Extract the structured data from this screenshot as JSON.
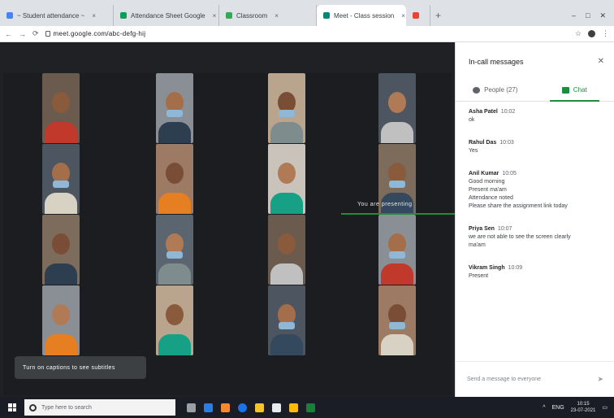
{
  "browser": {
    "tabs": [
      {
        "label": "~ Student attendance ~",
        "color": "#4285f4",
        "active": false
      },
      {
        "label": "Attendance Sheet Google",
        "color": "#0f9d58",
        "active": false
      },
      {
        "label": "Classroom",
        "color": "#34a853",
        "active": false
      },
      {
        "label": "Meet - Class session",
        "color": "#00897b",
        "active": true
      },
      {
        "label": "",
        "color": "#ea4335",
        "active": false
      }
    ],
    "new_tab": "+",
    "window_controls": [
      "–",
      "□",
      "✕"
    ],
    "url": "meet.google.com/abc-defg-hij",
    "nav": [
      "←",
      "→",
      "⟳"
    ],
    "omni_right": [
      "☆",
      "⋮"
    ]
  },
  "meet": {
    "presenter_label": "You are presenting",
    "caption_text": "Turn on captions to see subtitles"
  },
  "chat_panel": {
    "title": "In-call messages",
    "close": "✕",
    "tabs": [
      {
        "label": "People (27)",
        "active": false
      },
      {
        "label": "Chat",
        "active": true
      }
    ],
    "messages": [
      {
        "sender": "Asha Patel",
        "time": "10:02",
        "text": [
          "ok"
        ]
      },
      {
        "sender": "Rahul Das",
        "time": "10:03",
        "text": [
          "Yes"
        ]
      },
      {
        "sender": "Anil Kumar",
        "time": "10:05",
        "text": [
          "Good morning",
          "Present ma'am",
          "Attendance noted",
          "Please share the assignment link today"
        ]
      },
      {
        "sender": "Priya Sen",
        "time": "10:07",
        "text": [
          "we are not able to see the screen clearly",
          "ma'am"
        ]
      },
      {
        "sender": "Vikram Singh",
        "time": "10:09",
        "text": [
          "Present"
        ]
      }
    ],
    "input_placeholder": "Send a message to everyone",
    "send_icon": "➤"
  },
  "taskbar": {
    "search_placeholder": "Type here to search",
    "time": "10:15",
    "date": "23-07-2021",
    "lang": "ENG"
  }
}
